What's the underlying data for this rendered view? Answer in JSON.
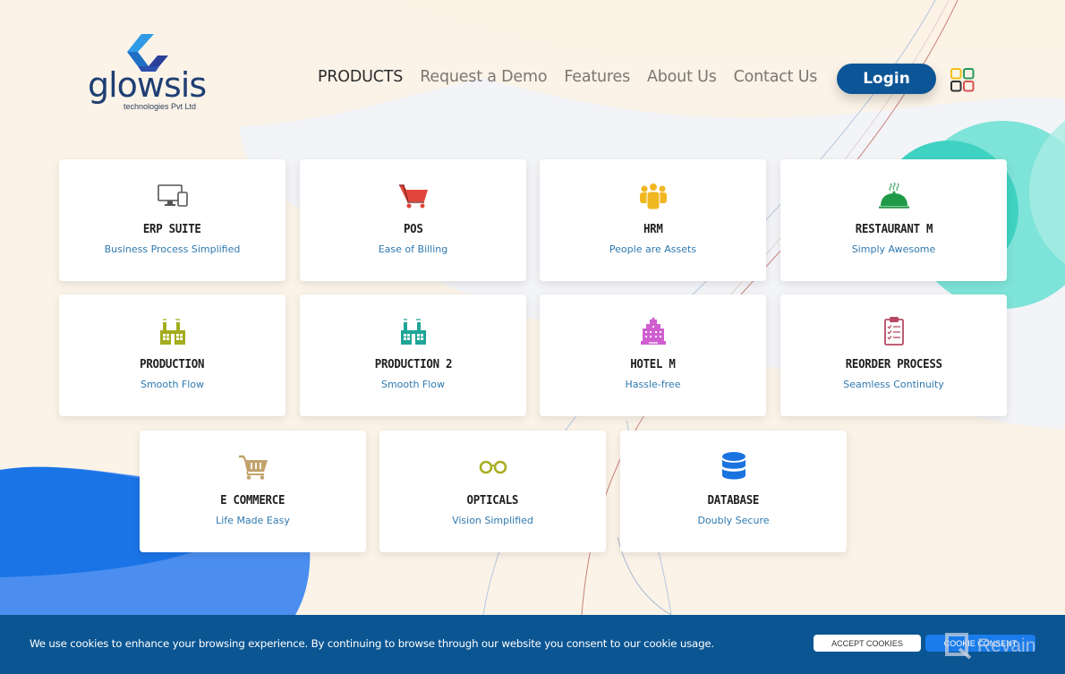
{
  "brand": {
    "name": "glowsis",
    "tagline": "technologies Pvt Ltd",
    "colors": {
      "primary": "#0c5596",
      "logo_light": "#2a8fe0",
      "logo_dark": "#1f3f73"
    }
  },
  "nav": {
    "items": [
      {
        "label": "PRODUCTS",
        "active": true
      },
      {
        "label": "Request a Demo",
        "active": false
      },
      {
        "label": "Features",
        "active": false
      },
      {
        "label": "About Us",
        "active": false
      },
      {
        "label": "Contact Us",
        "active": false
      }
    ],
    "login_label": "Login",
    "apps_icon": "grid-apps-icon"
  },
  "products": [
    {
      "title": "ERP SUITE",
      "subtitle": "Business Process Simplified",
      "icon": "desktop-tablet-icon",
      "color": "#555555"
    },
    {
      "title": "POS",
      "subtitle": "Ease of Billing",
      "icon": "shopping-cart-icon",
      "color": "#e0463b"
    },
    {
      "title": "HRM",
      "subtitle": "People are Assets",
      "icon": "people-group-icon",
      "color": "#f0b721"
    },
    {
      "title": "RESTAURANT M",
      "subtitle": "Simply Awesome",
      "icon": "food-cloche-icon",
      "color": "#1f9a48"
    },
    {
      "title": "PRODUCTION",
      "subtitle": "Smooth Flow",
      "icon": "factory-icon",
      "color": "#a3ad1e"
    },
    {
      "title": "PRODUCTION 2",
      "subtitle": "Smooth Flow",
      "icon": "factory-icon",
      "color": "#1fa597"
    },
    {
      "title": "HOTEL M",
      "subtitle": "Hassle-free",
      "icon": "hotel-building-icon",
      "color": "#cf5fd1"
    },
    {
      "title": "REORDER PROCESS",
      "subtitle": "Seamless Continuity",
      "icon": "clipboard-checklist-icon",
      "color": "#b54a62"
    },
    {
      "title": "E COMMERCE",
      "subtitle": "Life Made Easy",
      "icon": "basket-cart-icon",
      "color": "#c2a36d"
    },
    {
      "title": "OPTICALS",
      "subtitle": "Vision Simplified",
      "icon": "eyeglasses-icon",
      "color": "#a9ad22"
    },
    {
      "title": "DATABASE",
      "subtitle": "Doubly Secure",
      "icon": "database-icon",
      "color": "#1a73e0"
    }
  ],
  "cookie": {
    "message": "We use cookies to enhance your browsing experience. By continuing to browse through our website you consent to our cookie usage.",
    "accept_label": "ACCEPT COOKIES",
    "consent_label": "COOKIE CONSENT"
  },
  "watermark": {
    "label": "Revain"
  }
}
